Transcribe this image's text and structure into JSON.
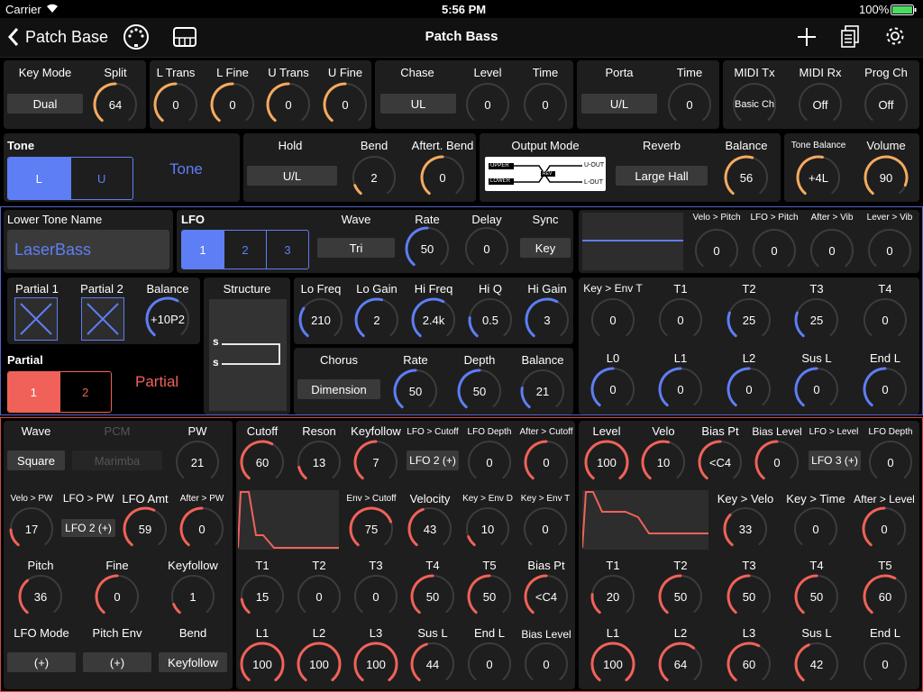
{
  "status": {
    "carrier": "Carrier",
    "time": "5:56 PM",
    "battery": "100%"
  },
  "nav": {
    "back": "Patch Base",
    "title": "Patch Bass"
  },
  "colors": {
    "orange": "#f5ab5e",
    "blue": "#5e7ef5",
    "red": "#f06259",
    "track": "#3c3c3c",
    "blueBorder": "#5a63c8",
    "redBorder": "#d14a45"
  },
  "top1": {
    "key_mode": {
      "label": "Key Mode",
      "value": "Dual"
    },
    "split": {
      "label": "Split",
      "value": "64"
    },
    "l_trans": {
      "label": "L Trans",
      "value": "0"
    },
    "l_fine": {
      "label": "L Fine",
      "value": "0"
    },
    "u_trans": {
      "label": "U Trans",
      "value": "0"
    },
    "u_fine": {
      "label": "U Fine",
      "value": "0"
    },
    "chase": {
      "label": "Chase",
      "value": "UL"
    },
    "level": {
      "label": "Level",
      "value": "0"
    },
    "time": {
      "label": "Time",
      "value": "0"
    },
    "porta": {
      "label": "Porta",
      "value": "U/L"
    },
    "porta_time": {
      "label": "Time",
      "value": "0"
    },
    "midi_tx": {
      "label": "MIDI Tx",
      "value": "Basic Ch"
    },
    "midi_rx": {
      "label": "MIDI Rx",
      "value": "Off"
    },
    "prog_ch": {
      "label": "Prog Ch",
      "value": "Off"
    }
  },
  "top2": {
    "tone": {
      "label": "Tone",
      "l": "L",
      "u": "U",
      "big": "Tone"
    },
    "hold": {
      "label": "Hold",
      "value": "U/L"
    },
    "bend": {
      "label": "Bend",
      "value": "2"
    },
    "aftert_bend": {
      "label": "Aftert. Bend",
      "value": "0"
    },
    "output_mode": {
      "label": "Output Mode",
      "upper": "UPPER",
      "lower": "LOWER",
      "uout": "U-OUT",
      "lout": "L-OUT",
      "rev": "REV"
    },
    "reverb": {
      "label": "Reverb",
      "value": "Large Hall"
    },
    "balance": {
      "label": "Balance",
      "value": "56"
    },
    "tone_balance": {
      "label": "Tone Balance",
      "value": "+4L"
    },
    "volume": {
      "label": "Volume",
      "value": "90"
    }
  },
  "lower": {
    "name_label": "Lower Tone Name",
    "name": "LaserBass",
    "lfo": {
      "label": "LFO",
      "tabs": [
        "1",
        "2",
        "3"
      ]
    },
    "wave": {
      "label": "Wave",
      "value": "Tri"
    },
    "rate": {
      "label": "Rate",
      "value": "50"
    },
    "delay": {
      "label": "Delay",
      "value": "0"
    },
    "sync": {
      "label": "Sync",
      "value": "Key"
    },
    "velo_pitch": {
      "label": "Velo > Pitch",
      "value": "0"
    },
    "lfo_pitch": {
      "label": "LFO > Pitch",
      "value": "0"
    },
    "after_vib": {
      "label": "After > Vib",
      "value": "0"
    },
    "lever_vib": {
      "label": "Lever > Vib",
      "value": "0"
    },
    "partial1": {
      "label": "Partial 1"
    },
    "partial2": {
      "label": "Partial 2"
    },
    "pbalance": {
      "label": "Balance",
      "value": "+10P2"
    },
    "structure": {
      "label": "Structure",
      "s1": "s",
      "s2": "s"
    },
    "partial": {
      "label": "Partial",
      "tabs": [
        "1",
        "2"
      ],
      "big": "Partial"
    },
    "lo_freq": {
      "label": "Lo Freq",
      "value": "210"
    },
    "lo_gain": {
      "label": "Lo Gain",
      "value": "2"
    },
    "hi_freq": {
      "label": "Hi Freq",
      "value": "2.4k"
    },
    "hi_q": {
      "label": "Hi Q",
      "value": "0.5"
    },
    "hi_gain": {
      "label": "Hi Gain",
      "value": "3"
    },
    "chorus": {
      "label": "Chorus",
      "value": "Dimension"
    },
    "c_rate": {
      "label": "Rate",
      "value": "50"
    },
    "c_depth": {
      "label": "Depth",
      "value": "50"
    },
    "c_balance": {
      "label": "Balance",
      "value": "21"
    },
    "key_env_t": {
      "label": "Key > Env T",
      "value": "0"
    },
    "t1": {
      "label": "T1",
      "value": "0"
    },
    "t2": {
      "label": "T2",
      "value": "25"
    },
    "t3": {
      "label": "T3",
      "value": "25"
    },
    "t4": {
      "label": "T4",
      "value": "0"
    },
    "l0": {
      "label": "L0",
      "value": "0"
    },
    "l1": {
      "label": "L1",
      "value": "0"
    },
    "l2": {
      "label": "L2",
      "value": "0"
    },
    "sus_l": {
      "label": "Sus L",
      "value": "0"
    },
    "end_l": {
      "label": "End L",
      "value": "0"
    }
  },
  "partial_sec": {
    "wave": {
      "label": "Wave",
      "value": "Square"
    },
    "pcm": {
      "label": "PCM",
      "value": "Marimba"
    },
    "pw": {
      "label": "PW",
      "value": "21"
    },
    "velo_pw": {
      "label": "Velo > PW",
      "value": "17"
    },
    "lfo_pw": {
      "label": "LFO > PW",
      "value": "LFO 2 (+)"
    },
    "lfo_amt": {
      "label": "LFO Amt",
      "value": "59"
    },
    "after_pw": {
      "label": "After > PW",
      "value": "0"
    },
    "pitch": {
      "label": "Pitch",
      "value": "36"
    },
    "fine": {
      "label": "Fine",
      "value": "0"
    },
    "keyfollow": {
      "label": "Keyfollow",
      "value": "1"
    },
    "lfo_mode": {
      "label": "LFO Mode",
      "value": "(+)"
    },
    "pitch_env": {
      "label": "Pitch Env",
      "value": "(+)"
    },
    "bend": {
      "label": "Bend",
      "value": "Keyfollow"
    },
    "cutoff": {
      "label": "Cutoff",
      "value": "60"
    },
    "reson": {
      "label": "Reson",
      "value": "13"
    },
    "f_keyfollow": {
      "label": "Keyfollow",
      "value": "7"
    },
    "lfo_cutoff": {
      "label": "LFO > Cutoff",
      "value": "LFO 2 (+)"
    },
    "lfo_depth": {
      "label": "LFO Depth",
      "value": "0"
    },
    "after_cutoff": {
      "label": "After > Cutoff",
      "value": "0"
    },
    "env_cutoff": {
      "label": "Env > Cutoff",
      "value": "75"
    },
    "velocity": {
      "label": "Velocity",
      "value": "43"
    },
    "key_env_d": {
      "label": "Key > Env D",
      "value": "10"
    },
    "key_env_t": {
      "label": "Key > Env T",
      "value": "0"
    },
    "ft1": {
      "label": "T1",
      "value": "15"
    },
    "ft2": {
      "label": "T2",
      "value": "0"
    },
    "ft3": {
      "label": "T3",
      "value": "0"
    },
    "ft4": {
      "label": "T4",
      "value": "50"
    },
    "ft5": {
      "label": "T5",
      "value": "50"
    },
    "bias_pt": {
      "label": "Bias Pt",
      "value": "<C4"
    },
    "fl1": {
      "label": "L1",
      "value": "100"
    },
    "fl2": {
      "label": "L2",
      "value": "100"
    },
    "fl3": {
      "label": "L3",
      "value": "100"
    },
    "fsus": {
      "label": "Sus L",
      "value": "44"
    },
    "fend": {
      "label": "End L",
      "value": "0"
    },
    "bias_level": {
      "label": "Bias Level",
      "value": "0"
    },
    "a_level": {
      "label": "Level",
      "value": "100"
    },
    "a_velo": {
      "label": "Velo",
      "value": "10"
    },
    "a_bias_pt": {
      "label": "Bias Pt",
      "value": "<C4"
    },
    "a_bias_level": {
      "label": "Bias Level",
      "value": "0"
    },
    "lfo_level": {
      "label": "LFO > Level",
      "value": "LFO 3 (+)"
    },
    "a_lfo_depth": {
      "label": "LFO Depth",
      "value": "0"
    },
    "key_velo": {
      "label": "Key > Velo",
      "value": "33"
    },
    "key_time": {
      "label": "Key > Time",
      "value": "0"
    },
    "after_level": {
      "label": "After > Level",
      "value": "0"
    },
    "at1": {
      "label": "T1",
      "value": "20"
    },
    "at2": {
      "label": "T2",
      "value": "50"
    },
    "at3": {
      "label": "T3",
      "value": "50"
    },
    "at4": {
      "label": "T4",
      "value": "50"
    },
    "at5": {
      "label": "T5",
      "value": "60"
    },
    "al1": {
      "label": "L1",
      "value": "100"
    },
    "al2": {
      "label": "L2",
      "value": "64"
    },
    "al3": {
      "label": "L3",
      "value": "60"
    },
    "asus": {
      "label": "Sus L",
      "value": "42"
    },
    "aend": {
      "label": "End L",
      "value": "0"
    }
  }
}
